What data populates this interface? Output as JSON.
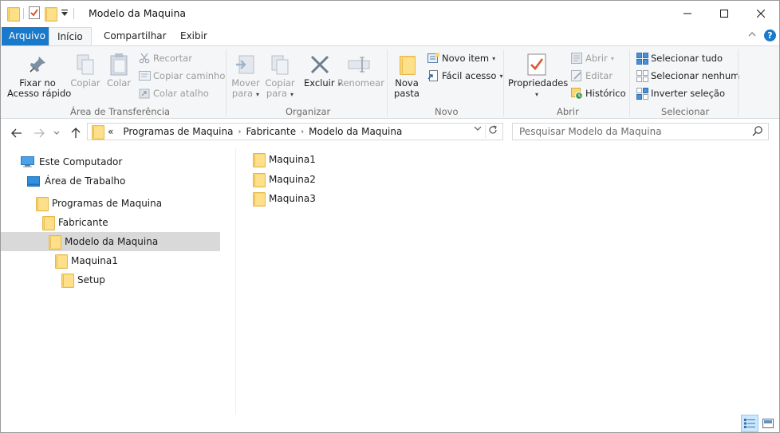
{
  "window": {
    "title": "Modelo da Maquina"
  },
  "ribbon_tabs": [
    {
      "label": "Arquivo"
    },
    {
      "label": "Início"
    },
    {
      "label": "Compartilhar"
    },
    {
      "label": "Exibir"
    }
  ],
  "ribbon": {
    "clipboard": {
      "group_label": "Área de Transferência",
      "pin_label_1": "Fixar no",
      "pin_label_2": "Acesso rápido",
      "copy_label": "Copiar",
      "paste_label": "Colar",
      "cut_label": "Recortar",
      "copy_path_label": "Copiar caminho",
      "paste_shortcut_label": "Colar atalho"
    },
    "organize": {
      "group_label": "Organizar",
      "move_label_1": "Mover",
      "move_label_2": "para",
      "copyto_label_1": "Copiar",
      "copyto_label_2": "para",
      "delete_label": "Excluir",
      "rename_label": "Renomear"
    },
    "new": {
      "group_label": "Novo",
      "new_folder_label_1": "Nova",
      "new_folder_label_2": "pasta",
      "new_item_label": "Novo item",
      "easy_access_label": "Fácil acesso"
    },
    "open": {
      "group_label": "Abrir",
      "properties_label": "Propriedades",
      "open_label": "Abrir",
      "edit_label": "Editar",
      "history_label": "Histórico"
    },
    "select": {
      "group_label": "Selecionar",
      "select_all_label": "Selecionar tudo",
      "select_none_label": "Selecionar nenhum",
      "invert_label": "Inverter seleção"
    }
  },
  "address": {
    "prefix": "«",
    "crumbs": [
      "Programas de Maquina",
      "Fabricante",
      "Modelo da Maquina"
    ]
  },
  "search": {
    "placeholder": "Pesquisar Modelo da Maquina"
  },
  "nav_tree": [
    {
      "label": "Este Computador",
      "icon": "computer-icon"
    },
    {
      "label": "Área de Trabalho",
      "icon": "desktop-icon"
    },
    {
      "label": "Programas de Maquina",
      "icon": "folder-icon"
    },
    {
      "label": "Fabricante",
      "icon": "folder-icon"
    },
    {
      "label": "Modelo da Maquina",
      "icon": "folder-icon",
      "selected": true
    },
    {
      "label": "Maquina1",
      "icon": "folder-icon"
    },
    {
      "label": "Setup",
      "icon": "folder-icon"
    }
  ],
  "files": [
    {
      "name": "Maquina1"
    },
    {
      "name": "Maquina2"
    },
    {
      "name": "Maquina3"
    }
  ],
  "colors": {
    "accent": "#1979ca",
    "folder": "#f8d775",
    "selection": "#d9d9d9"
  }
}
